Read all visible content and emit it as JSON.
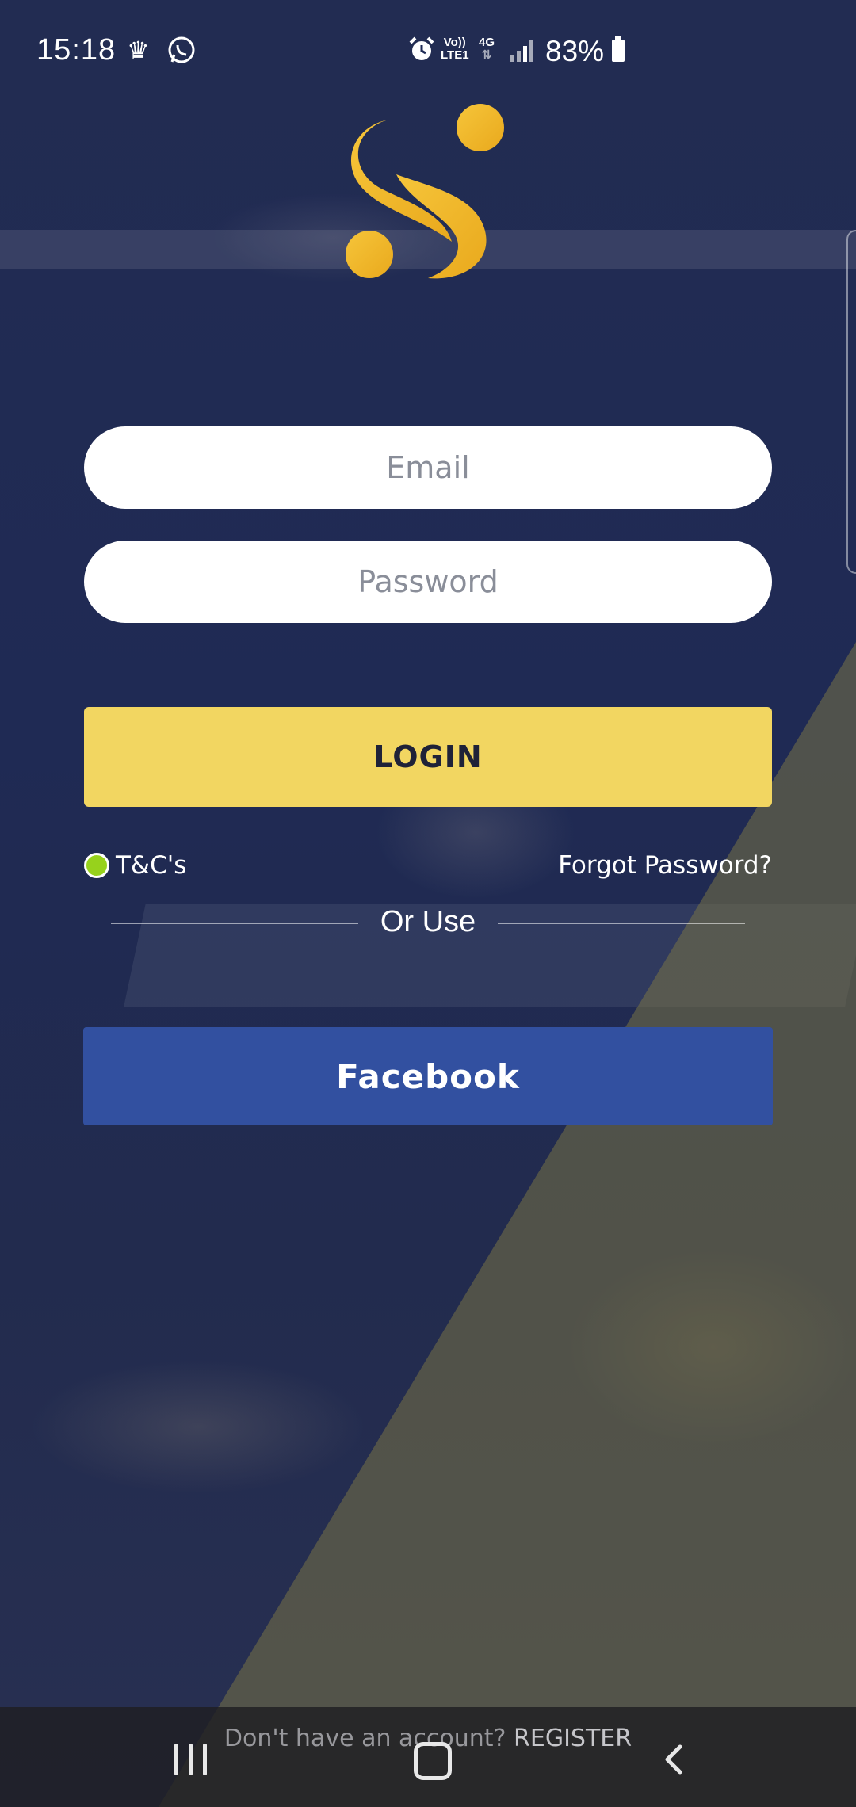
{
  "status_bar": {
    "time": "15:18",
    "volte": "Vo))",
    "lte": "LTE1",
    "network": "4G",
    "battery_percent": "83%",
    "icons": [
      "crown-icon",
      "whatsapp-icon",
      "alarm-icon",
      "signal-icon",
      "battery-icon"
    ]
  },
  "login_form": {
    "email_placeholder": "Email",
    "password_placeholder": "Password",
    "login_label": "LOGIN",
    "tc_label": "T&C's",
    "forgot_password_label": "Forgot Password?",
    "or_use_label": "Or Use",
    "facebook_label": "Facebook"
  },
  "footer": {
    "register_prompt": "Don't have an account?",
    "register_label": "REGISTER"
  },
  "colors": {
    "background": "#1e2a55",
    "accent_yellow": "#f2d661",
    "facebook_blue": "#3250a0",
    "tc_green": "#97d21c",
    "logo_gold": "#f2b72a"
  }
}
